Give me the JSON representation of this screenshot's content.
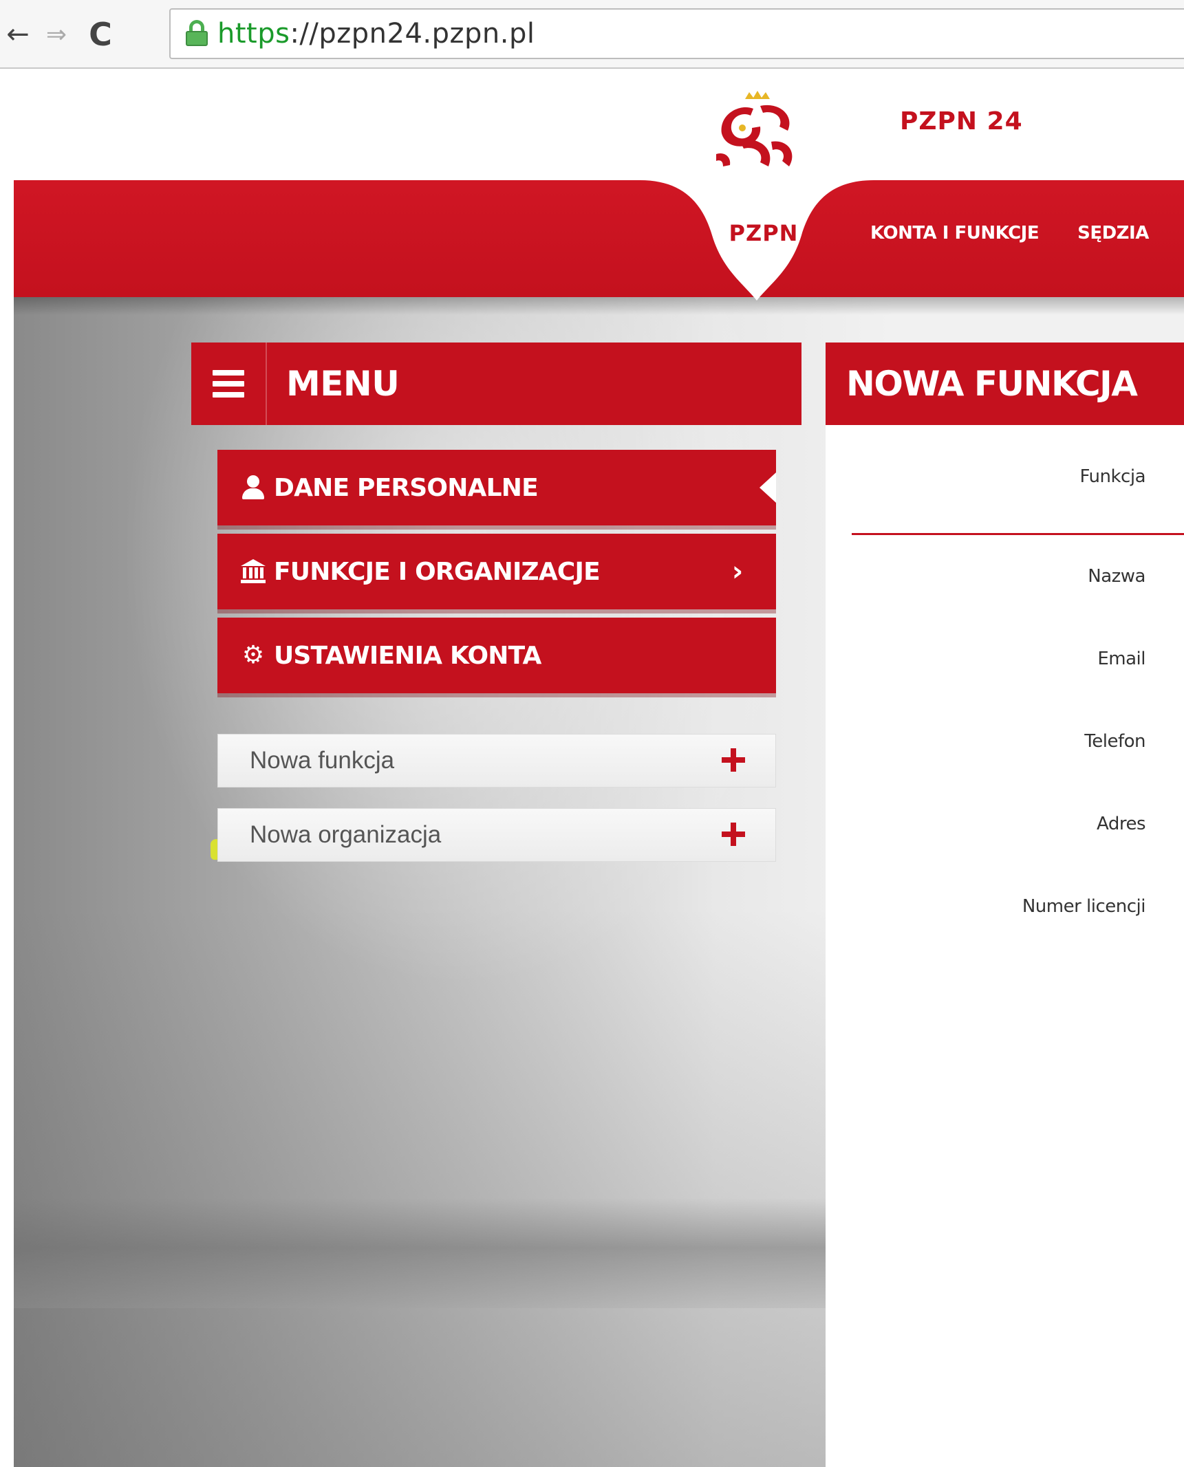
{
  "browser": {
    "url_scheme": "https",
    "url_rest": "://pzpn24.pzpn.pl",
    "back_icon": "arrow-left",
    "forward_icon": "arrow-right",
    "reload_icon": "reload",
    "lock_icon": "padlock"
  },
  "header": {
    "crest_label": "PZPN",
    "site_title": "PZPN 24",
    "nav": [
      "KONTA I FUNKCJE",
      "SĘDZIA"
    ]
  },
  "menu": {
    "title": "MENU",
    "items": [
      {
        "label": "DANE PERSONALNE",
        "icon": "user-icon",
        "active": true
      },
      {
        "label": "FUNKCJE I ORGANIZACJE",
        "icon": "bank-icon",
        "chevron": "chevron-right-icon"
      },
      {
        "label": "USTAWIENIA KONTA",
        "icon": "gear-icon"
      }
    ],
    "sub_items": [
      {
        "label": "Nowa funkcja",
        "icon": "plus-icon",
        "highlighted": true
      },
      {
        "label": "Nowa organizacja",
        "icon": "plus-icon"
      }
    ]
  },
  "form": {
    "title": "NOWA FUNKCJA",
    "fields": [
      "Funkcja",
      "Nazwa",
      "Email",
      "Telefon",
      "Adres",
      "Numer licencji"
    ]
  },
  "colors": {
    "brand_red": "#c4111e",
    "highlight": "#e6f014",
    "url_scheme_green": "#1a9a2a"
  }
}
